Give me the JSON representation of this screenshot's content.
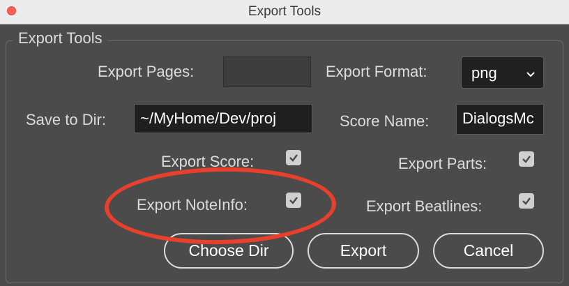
{
  "window": {
    "title": "Export Tools"
  },
  "group": {
    "title": "Export Tools"
  },
  "export_pages": {
    "label": "Export Pages:",
    "value": ""
  },
  "export_format": {
    "label": "Export Format:",
    "value": "png"
  },
  "save_to_dir": {
    "label": "Save to Dir:",
    "value": "~/MyHome/Dev/proj"
  },
  "score_name": {
    "label": "Score Name:",
    "value": "DialogsMc"
  },
  "checkboxes": {
    "export_score": {
      "label": "Export Score:",
      "checked": true
    },
    "export_parts": {
      "label": "Export Parts:",
      "checked": true
    },
    "export_noteinfo": {
      "label": "Export NoteInfo:",
      "checked": true
    },
    "export_beatlines": {
      "label": "Export Beatlines:",
      "checked": true
    }
  },
  "buttons": {
    "choose_dir": "Choose Dir",
    "export": "Export",
    "cancel": "Cancel"
  },
  "annotation": {
    "color": "#e8402c"
  }
}
